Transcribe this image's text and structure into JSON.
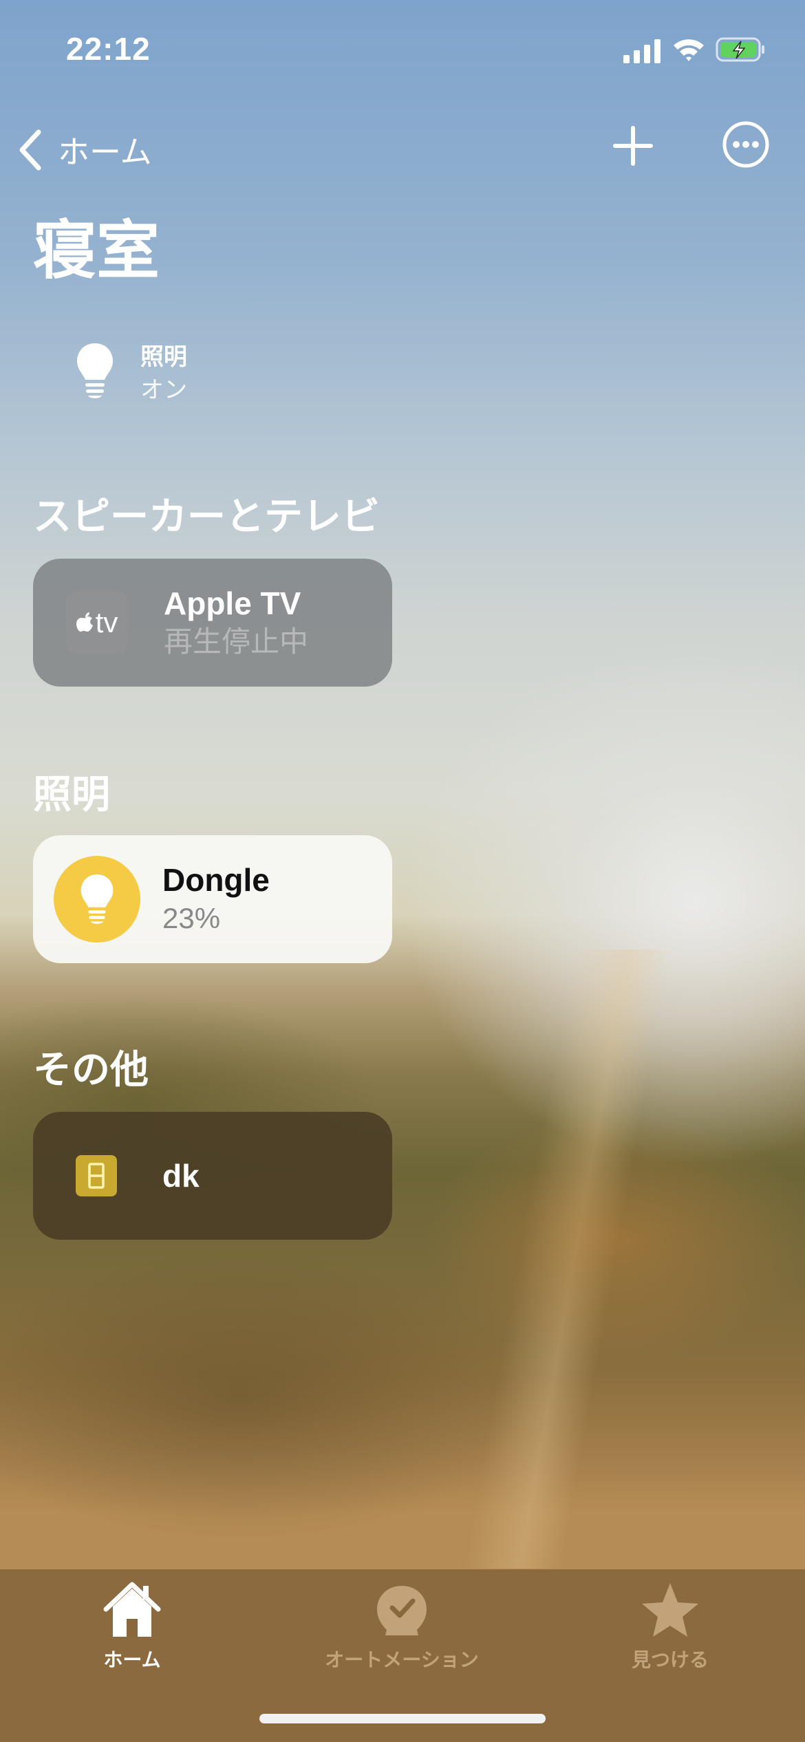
{
  "status_bar": {
    "time": "22:12"
  },
  "nav": {
    "back_label": "ホーム"
  },
  "room": {
    "title": "寝室"
  },
  "room_status": {
    "name": "照明",
    "value": "オン"
  },
  "sections": {
    "speakers_tv": "スピーカーとテレビ",
    "lighting": "照明",
    "other": "その他"
  },
  "accessories": {
    "apple_tv": {
      "icon_text": "tv",
      "name": "Apple TV",
      "state": "再生停止中"
    },
    "dongle": {
      "name": "Dongle",
      "state": "23%"
    },
    "dk": {
      "name": "dk"
    }
  },
  "tabs": [
    {
      "label": "ホーム",
      "icon": "house-icon",
      "selected": true
    },
    {
      "label": "オートメーション",
      "icon": "automation-icon",
      "selected": false
    },
    {
      "label": "見つける",
      "icon": "star-icon",
      "selected": false
    }
  ],
  "colors": {
    "bulb_active": "#f5cb46",
    "battery_charge": "#5fd35d",
    "tab_selected": "#ffffff",
    "tab_unselected": "#c2a279"
  }
}
